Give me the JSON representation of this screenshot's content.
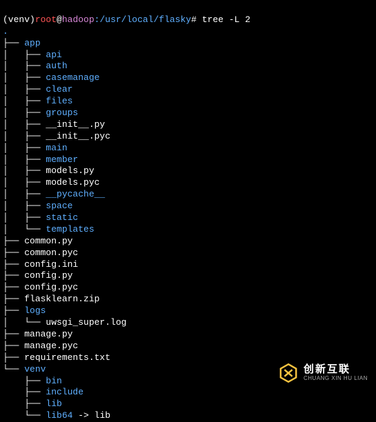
{
  "prompt": {
    "venv": "(venv)",
    "user": "root",
    "at": "@",
    "host": "hadoop",
    "colon": ":",
    "path": "/usr/local/flasky",
    "hash": "#",
    "command": "tree -L 2"
  },
  "dot": ".",
  "tree": [
    {
      "prefix": "├── ",
      "name": "app",
      "type": "dir"
    },
    {
      "prefix": "│   ├── ",
      "name": "api",
      "type": "dir"
    },
    {
      "prefix": "│   ├── ",
      "name": "auth",
      "type": "dir"
    },
    {
      "prefix": "│   ├── ",
      "name": "casemanage",
      "type": "dir"
    },
    {
      "prefix": "│   ├── ",
      "name": "clear",
      "type": "dir"
    },
    {
      "prefix": "│   ├── ",
      "name": "files",
      "type": "dir"
    },
    {
      "prefix": "│   ├── ",
      "name": "groups",
      "type": "dir"
    },
    {
      "prefix": "│   ├── ",
      "name": "__init__.py",
      "type": "file"
    },
    {
      "prefix": "│   ├── ",
      "name": "__init__.pyc",
      "type": "file"
    },
    {
      "prefix": "│   ├── ",
      "name": "main",
      "type": "dir"
    },
    {
      "prefix": "│   ├── ",
      "name": "member",
      "type": "dir"
    },
    {
      "prefix": "│   ├── ",
      "name": "models.py",
      "type": "file"
    },
    {
      "prefix": "│   ├── ",
      "name": "models.pyc",
      "type": "file"
    },
    {
      "prefix": "│   ├── ",
      "name": "__pycache__",
      "type": "dir"
    },
    {
      "prefix": "│   ├── ",
      "name": "space",
      "type": "dir"
    },
    {
      "prefix": "│   ├── ",
      "name": "static",
      "type": "dir"
    },
    {
      "prefix": "│   └── ",
      "name": "templates",
      "type": "dir"
    },
    {
      "prefix": "├── ",
      "name": "common.py",
      "type": "file"
    },
    {
      "prefix": "├── ",
      "name": "common.pyc",
      "type": "file"
    },
    {
      "prefix": "├── ",
      "name": "config.ini",
      "type": "file"
    },
    {
      "prefix": "├── ",
      "name": "config.py",
      "type": "file"
    },
    {
      "prefix": "├── ",
      "name": "config.pyc",
      "type": "file"
    },
    {
      "prefix": "├── ",
      "name": "flasklearn.zip",
      "type": "file"
    },
    {
      "prefix": "├── ",
      "name": "logs",
      "type": "dir"
    },
    {
      "prefix": "│   └── ",
      "name": "uwsgi_super.log",
      "type": "file"
    },
    {
      "prefix": "├── ",
      "name": "manage.py",
      "type": "file"
    },
    {
      "prefix": "├── ",
      "name": "manage.pyc",
      "type": "file"
    },
    {
      "prefix": "├── ",
      "name": "requirements.txt",
      "type": "file"
    },
    {
      "prefix": "└── ",
      "name": "venv",
      "type": "dir"
    },
    {
      "prefix": "    ├── ",
      "name": "bin",
      "type": "dir"
    },
    {
      "prefix": "    ├── ",
      "name": "include",
      "type": "dir"
    },
    {
      "prefix": "    ├── ",
      "name": "lib",
      "type": "dir"
    },
    {
      "prefix": "    └── ",
      "name": "lib64",
      "type": "dir",
      "link": " -> lib"
    }
  ],
  "watermark": {
    "cn": "创新互联",
    "en": "CHUANG XIN HU LIAN"
  }
}
